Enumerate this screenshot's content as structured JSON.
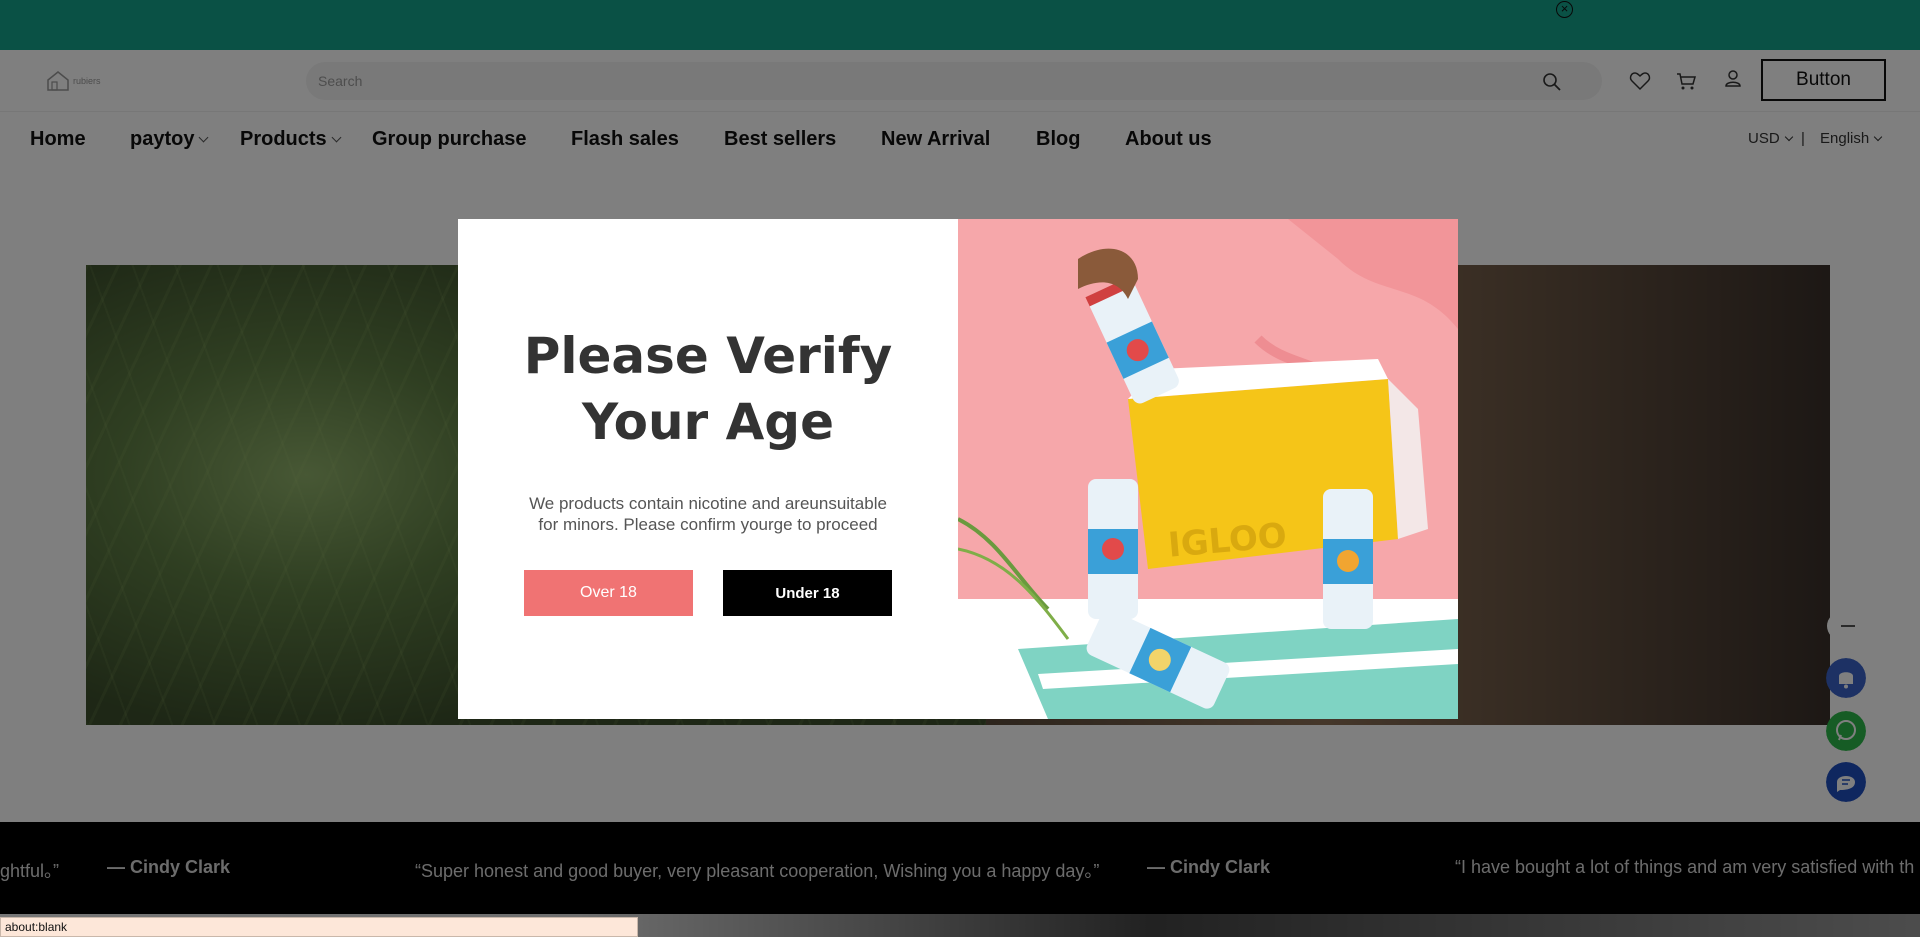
{
  "header": {
    "logo_text": "rubiers",
    "search_placeholder": "Search",
    "button_label": "Button"
  },
  "nav": {
    "items": [
      {
        "label": "Home",
        "has_dropdown": false
      },
      {
        "label": "paytoy",
        "has_dropdown": true
      },
      {
        "label": "Products",
        "has_dropdown": true
      },
      {
        "label": "Group purchase",
        "has_dropdown": false
      },
      {
        "label": "Flash sales",
        "has_dropdown": false
      },
      {
        "label": "Best sellers",
        "has_dropdown": false
      },
      {
        "label": "New Arrival",
        "has_dropdown": false
      },
      {
        "label": "Blog",
        "has_dropdown": false
      },
      {
        "label": "About us",
        "has_dropdown": false
      }
    ],
    "currency": "USD",
    "separator": "|",
    "language": "English"
  },
  "modal": {
    "title_line1": "Please Verify",
    "title_line2": "Your Age",
    "description": "We products contain nicotine and areunsuitable for minors. Please confirm yourge to proceed",
    "over_label": "Over 18",
    "under_label": "Under 18",
    "image_label": "IGLOO"
  },
  "testimonials": [
    {
      "text": "ghtful。”",
      "author": "— Cindy Clark"
    },
    {
      "text": "“Super honest and good buyer, very pleasant cooperation, Wishing you a happy day。”",
      "author": "— Cindy Clark"
    },
    {
      "text": "“I have bought a lot of things and am very satisfied with th"
    }
  ],
  "status_bar": "about:blank",
  "colors": {
    "topbar": "#14a28b",
    "over_button": "#f07373",
    "under_button": "#000000",
    "modal_image_bg": "#f6a7aa"
  },
  "icons": {
    "search": "search-icon",
    "wishlist": "heart-icon",
    "cart": "cart-icon",
    "account": "user-icon",
    "close": "close-icon"
  }
}
